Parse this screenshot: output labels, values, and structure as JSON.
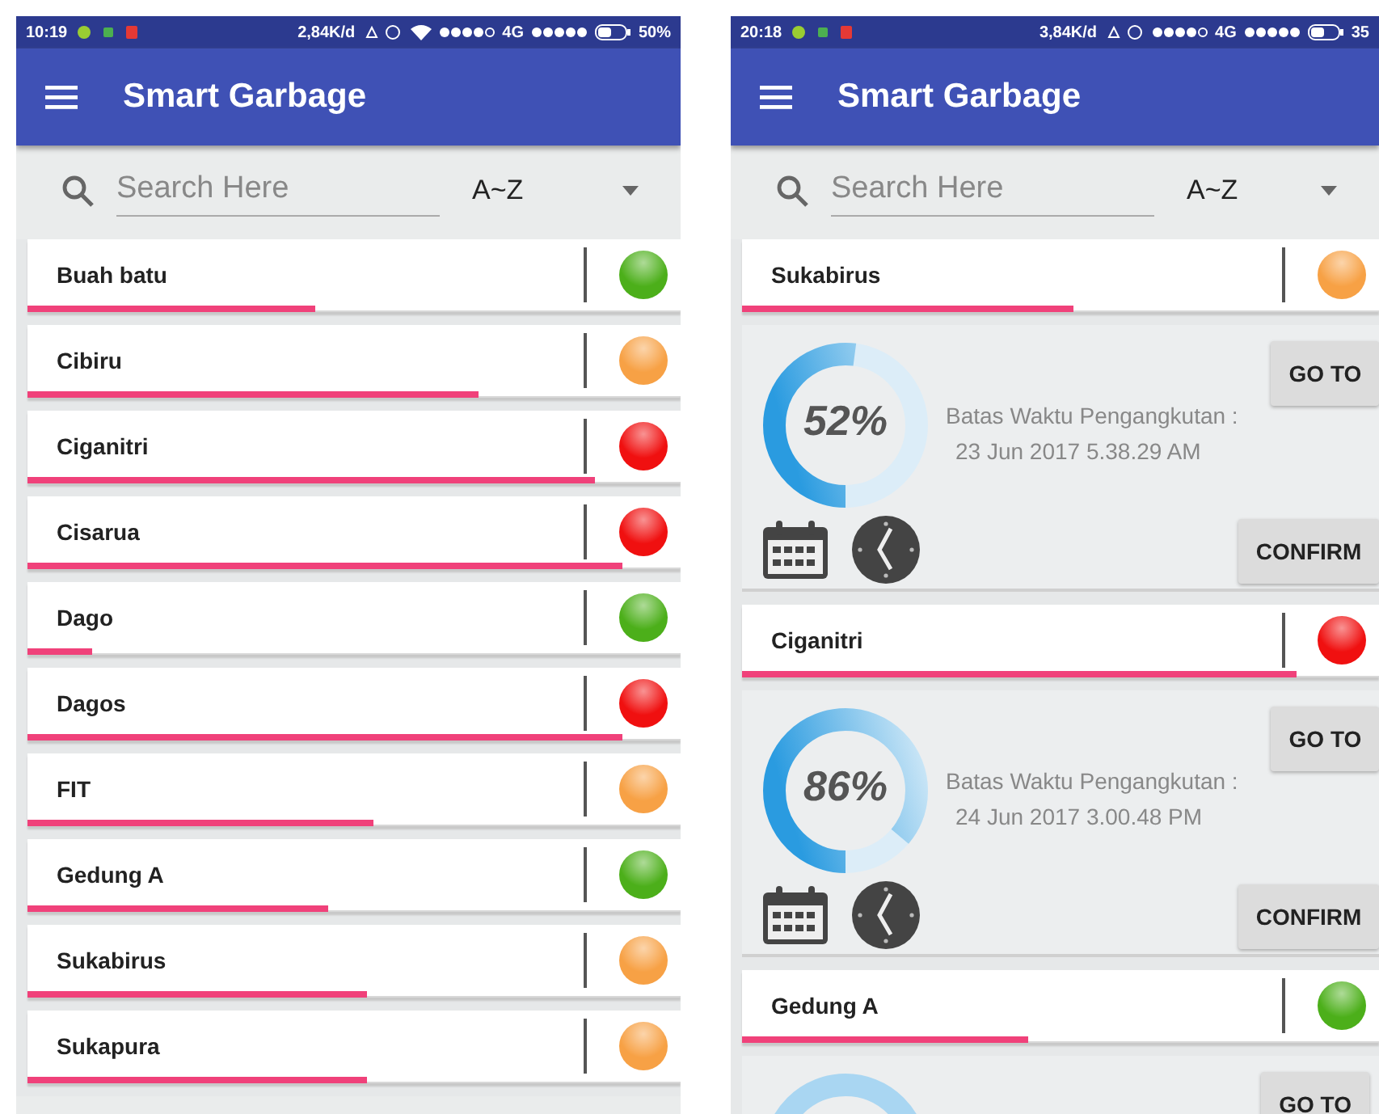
{
  "phones": [
    {
      "status_bar": {
        "time": "10:19",
        "speed": "2,84K/d",
        "wifi": true,
        "network": "4G",
        "battery": "50%"
      },
      "title": "Smart Garbage",
      "search": {
        "placeholder": "Search Here"
      },
      "sort": "A~Z",
      "items": [
        {
          "kind": "row",
          "name": "Buah batu",
          "level": 0.44,
          "color": "#4caf1a"
        },
        {
          "kind": "row",
          "name": "Cibiru",
          "level": 0.69,
          "color": "#f7a145"
        },
        {
          "kind": "row",
          "name": "Ciganitri",
          "level": 0.87,
          "color": "#f01010"
        },
        {
          "kind": "row",
          "name": "Cisarua",
          "level": 0.91,
          "color": "#f01010"
        },
        {
          "kind": "row",
          "name": "Dago",
          "level": 0.1,
          "color": "#4caf1a"
        },
        {
          "kind": "row",
          "name": "Dagos",
          "level": 0.91,
          "color": "#f01010"
        },
        {
          "kind": "row",
          "name": "FIT",
          "level": 0.53,
          "color": "#f7a145"
        },
        {
          "kind": "row",
          "name": "Gedung A",
          "level": 0.46,
          "color": "#4caf1a"
        },
        {
          "kind": "row",
          "name": "Sukabirus",
          "level": 0.52,
          "color": "#f7a145"
        },
        {
          "kind": "row",
          "name": "Sukapura",
          "level": 0.52,
          "color": "#f7a145"
        }
      ]
    },
    {
      "status_bar": {
        "time": "20:18",
        "speed": "3,84K/d",
        "wifi": false,
        "network": "4G",
        "battery": "35"
      },
      "title": "Smart Garbage",
      "search": {
        "placeholder": "Search Here"
      },
      "sort": "A~Z",
      "items": [
        {
          "kind": "row",
          "name": "Sukabirus",
          "level": 0.52,
          "color": "#f7a145"
        },
        {
          "kind": "detail",
          "percent": "52%",
          "level": 0.52,
          "label": "Batas Waktu Pengangkutan :",
          "datetime": "23 Jun 2017 5.38.29 AM",
          "goto": "GO TO",
          "confirm": "CONFIRM"
        },
        {
          "kind": "row",
          "name": "Ciganitri",
          "level": 0.87,
          "color": "#f01010"
        },
        {
          "kind": "detail",
          "percent": "86%",
          "level": 0.86,
          "label": "Batas Waktu Pengangkutan :",
          "datetime": "24 Jun 2017 3.00.48 PM",
          "goto": "GO TO",
          "confirm": "CONFIRM"
        },
        {
          "kind": "row",
          "name": "Gedung A",
          "level": 0.45,
          "color": "#4caf1a"
        },
        {
          "kind": "detail",
          "goto": "GO TO"
        }
      ]
    }
  ]
}
